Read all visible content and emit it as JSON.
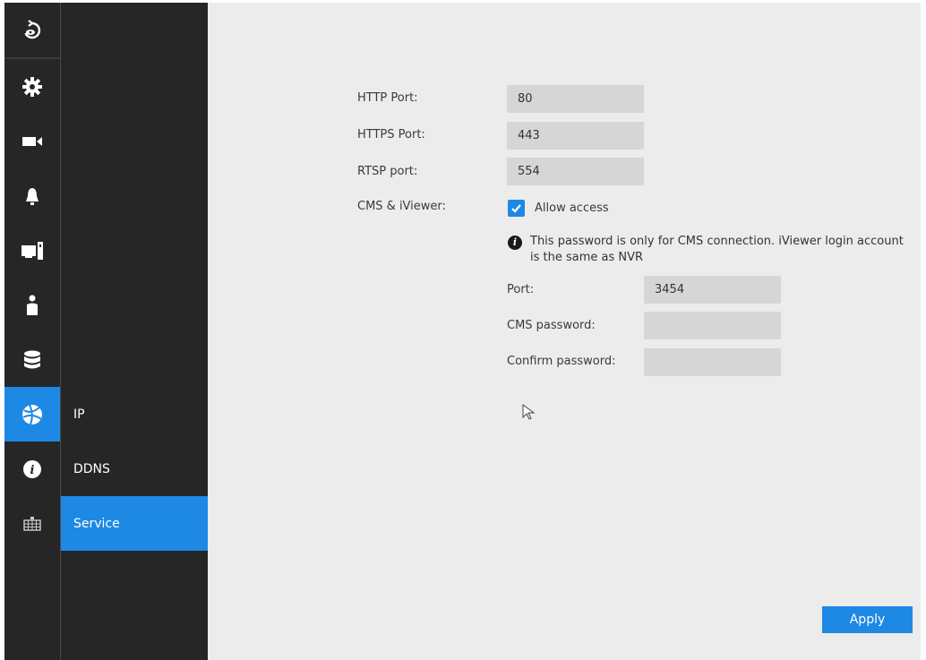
{
  "rail": {
    "items": [
      {
        "icon": "back-icon",
        "active": false
      },
      {
        "icon": "gear-icon",
        "active": false
      },
      {
        "icon": "camera-icon",
        "active": false
      },
      {
        "icon": "bell-icon",
        "active": false
      },
      {
        "icon": "monitor-icon",
        "active": false
      },
      {
        "icon": "user-icon",
        "active": false
      },
      {
        "icon": "database-icon",
        "active": false
      },
      {
        "icon": "globe-icon",
        "active": true
      },
      {
        "icon": "info-icon",
        "active": false
      },
      {
        "icon": "keyboard-icon",
        "active": false
      }
    ]
  },
  "submenu": {
    "items": [
      {
        "label": "IP",
        "active": false
      },
      {
        "label": "DDNS",
        "active": false
      },
      {
        "label": "Service",
        "active": true
      }
    ]
  },
  "form": {
    "http_port_label": "HTTP Port:",
    "http_port_value": "80",
    "https_port_label": "HTTPS Port:",
    "https_port_value": "443",
    "rtsp_port_label": "RTSP port:",
    "rtsp_port_value": "554",
    "cms_label": "CMS & iViewer:",
    "allow_access_label": "Allow access",
    "allow_access_checked": true,
    "info_text": "This password is only for CMS connection. iViewer login account is the same as NVR",
    "port_label": "Port:",
    "port_value": "3454",
    "cms_password_label": "CMS password:",
    "cms_password_value": "",
    "confirm_password_label": "Confirm password:",
    "confirm_password_value": ""
  },
  "apply_label": "Apply",
  "colors": {
    "accent": "#1e88e5",
    "sidebar": "#262626",
    "content_bg": "#ececec",
    "field_bg": "#d6d6d6"
  }
}
